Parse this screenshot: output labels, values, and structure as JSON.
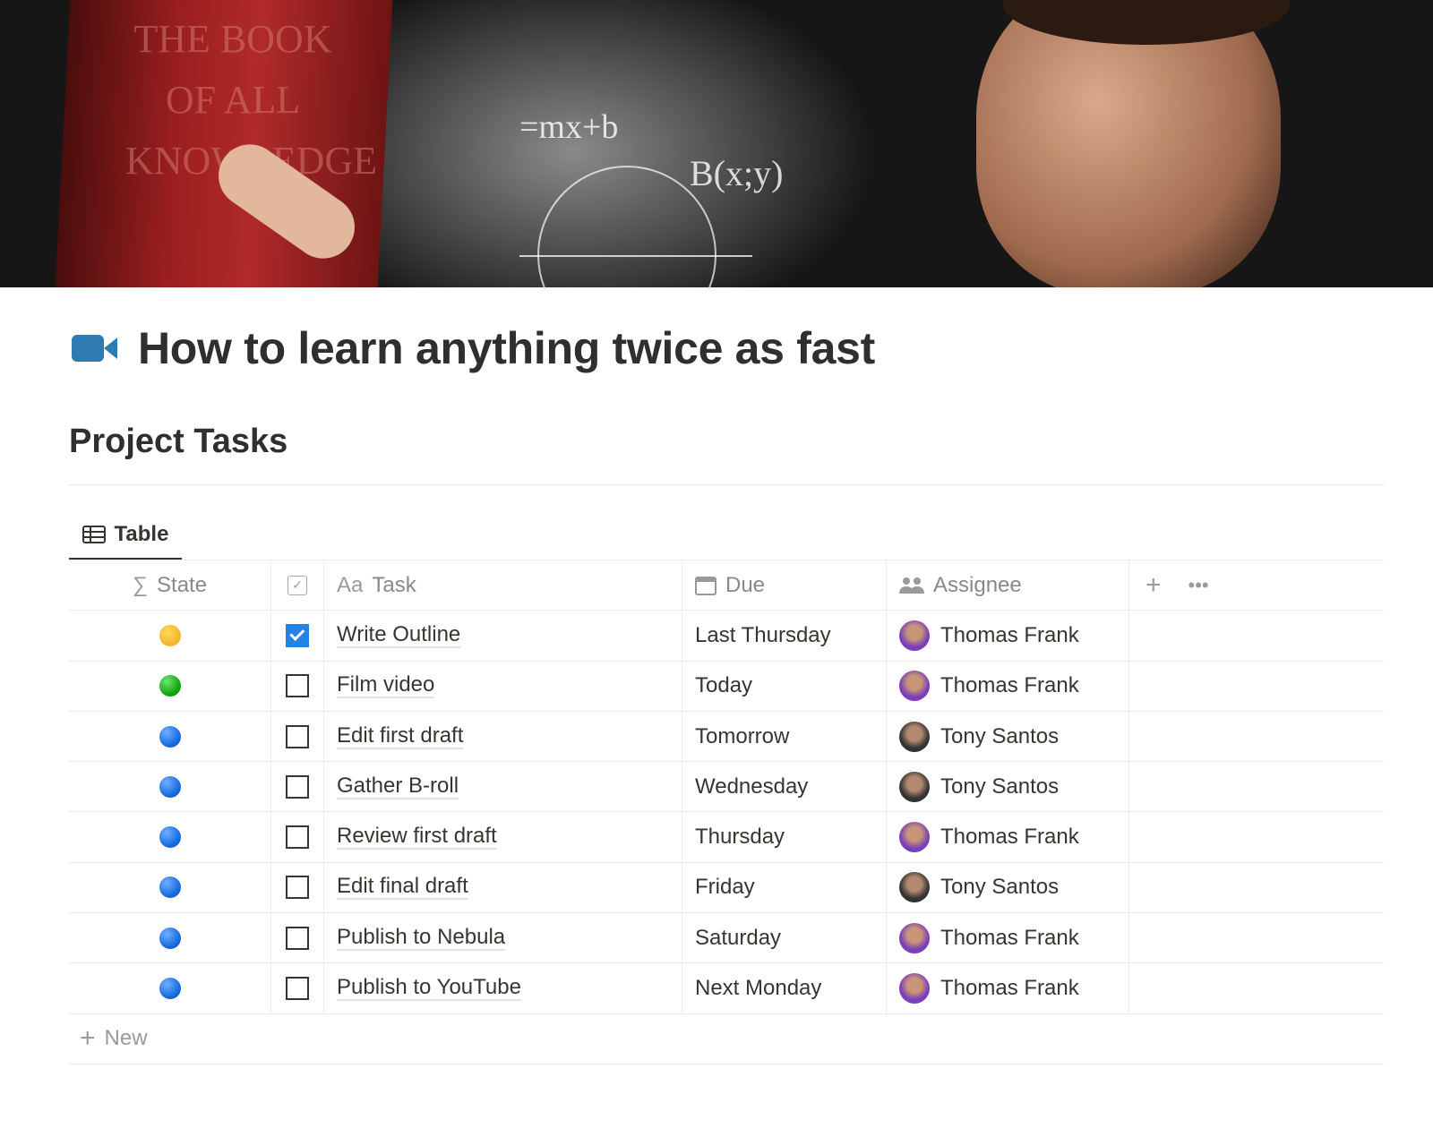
{
  "banner": {
    "book_text": "THE BOOK OF ALL KNOWLEDGE",
    "formula_1": "=mx+b",
    "formula_2": "B(x;y)"
  },
  "page": {
    "icon": "video-camera-icon",
    "icon_color": "#2e7bb0",
    "title": "How to learn anything twice as fast"
  },
  "section": {
    "title": "Project Tasks"
  },
  "view_tab": {
    "icon": "table-icon",
    "label": "Table"
  },
  "table": {
    "headers": {
      "state": "State",
      "task": "Task",
      "task_icon": "Aa",
      "due": "Due",
      "assignee": "Assignee"
    },
    "rows": [
      {
        "state": "grinning-face",
        "done": true,
        "task": "Write Outline",
        "due": "Last Thursday",
        "assignee": "Thomas Frank"
      },
      {
        "state": "green-circle",
        "done": false,
        "task": "Film video",
        "due": "Today",
        "assignee": "Thomas Frank"
      },
      {
        "state": "blue-circle",
        "done": false,
        "task": "Edit first draft",
        "due": "Tomorrow",
        "assignee": "Tony Santos"
      },
      {
        "state": "blue-circle",
        "done": false,
        "task": "Gather B-roll",
        "due": "Wednesday",
        "assignee": "Tony Santos"
      },
      {
        "state": "blue-circle",
        "done": false,
        "task": "Review first draft",
        "due": "Thursday",
        "assignee": "Thomas Frank"
      },
      {
        "state": "blue-circle",
        "done": false,
        "task": "Edit final draft",
        "due": "Friday",
        "assignee": "Tony Santos"
      },
      {
        "state": "blue-circle",
        "done": false,
        "task": "Publish to Nebula",
        "due": "Saturday",
        "assignee": "Thomas Frank"
      },
      {
        "state": "blue-circle",
        "done": false,
        "task": "Publish to YouTube",
        "due": "Next Monday",
        "assignee": "Thomas Frank"
      }
    ],
    "new_label": "New"
  },
  "colors": {
    "checkbox_checked": "#2383e2",
    "green": "#1fb81f",
    "blue": "#1a6fe0"
  }
}
